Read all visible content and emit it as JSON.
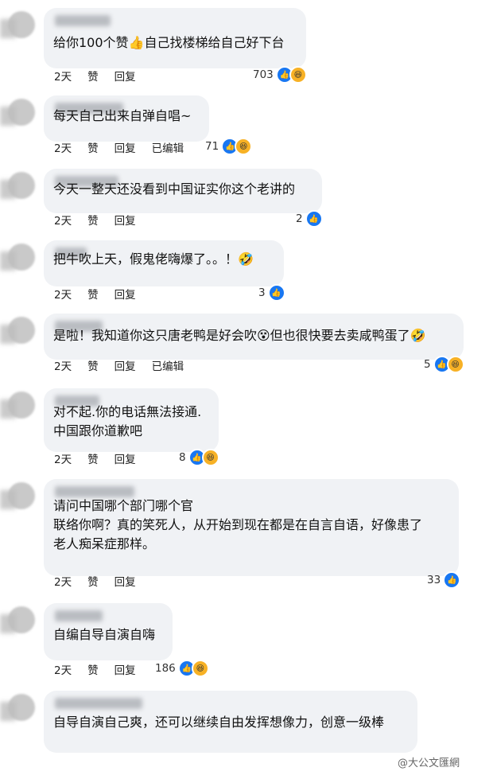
{
  "comments": [
    {
      "text": [
        "给你100个赞👍自己找楼梯给自己好下台"
      ],
      "time": "2天",
      "like": "赞",
      "reply": "回复",
      "edited": "",
      "count": "703",
      "reactions": [
        "like",
        "haha"
      ]
    },
    {
      "text": [
        "每天自己出来自弹自唱~"
      ],
      "time": "2天",
      "like": "赞",
      "reply": "回复",
      "edited": "已编辑",
      "count": "71",
      "reactions": [
        "like",
        "haha"
      ]
    },
    {
      "text": [
        "今天一整天还没看到中国证实你这个老讲的"
      ],
      "time": "2天",
      "like": "赞",
      "reply": "回复",
      "edited": "",
      "count": "2",
      "reactions": [
        "like"
      ]
    },
    {
      "text": [
        "把牛吹上天，假鬼佬嗨爆了。。！🤣"
      ],
      "time": "2天",
      "like": "赞",
      "reply": "回复",
      "edited": "",
      "count": "3",
      "reactions": [
        "like"
      ]
    },
    {
      "text": [
        "是啦！我知道你这只唐老鸭是好会吹😵但也很快要去卖咸鸭蛋了🤣"
      ],
      "time": "2天",
      "like": "赞",
      "reply": "回复",
      "edited": "已编辑",
      "count": "5",
      "reactions": [
        "like",
        "haha"
      ]
    },
    {
      "text": [
        "对不起.你的电话無法接通.",
        "中国跟你道歉吧"
      ],
      "time": "2天",
      "like": "赞",
      "reply": "回复",
      "edited": "",
      "count": "8",
      "reactions": [
        "like",
        "haha"
      ]
    },
    {
      "text": [
        "请问中国哪个部门哪个官",
        "联络你啊？真的笑死人，从开始到现在都是在自言自语，好像患了",
        "老人痴呆症那样。"
      ],
      "time": "2天",
      "like": "赞",
      "reply": "回复",
      "edited": "",
      "count": "33",
      "reactions": [
        "like"
      ]
    },
    {
      "text": [
        "自编自导自演自嗨"
      ],
      "time": "2天",
      "like": "赞",
      "reply": "回复",
      "edited": "",
      "count": "186",
      "reactions": [
        "like",
        "haha"
      ]
    },
    {
      "text": [
        "自导自演自己爽，还可以继续自由发挥想像力，创意一级棒"
      ],
      "time": "",
      "like": "",
      "reply": "",
      "edited": "",
      "count": "",
      "reactions": []
    }
  ],
  "watermark": "@大公文匯網",
  "colors": {
    "bubble": "#f0f2f5",
    "like": "#1877f2",
    "haha": "#f7b125"
  },
  "icons": {
    "like": "like-icon",
    "haha": "haha-icon"
  }
}
